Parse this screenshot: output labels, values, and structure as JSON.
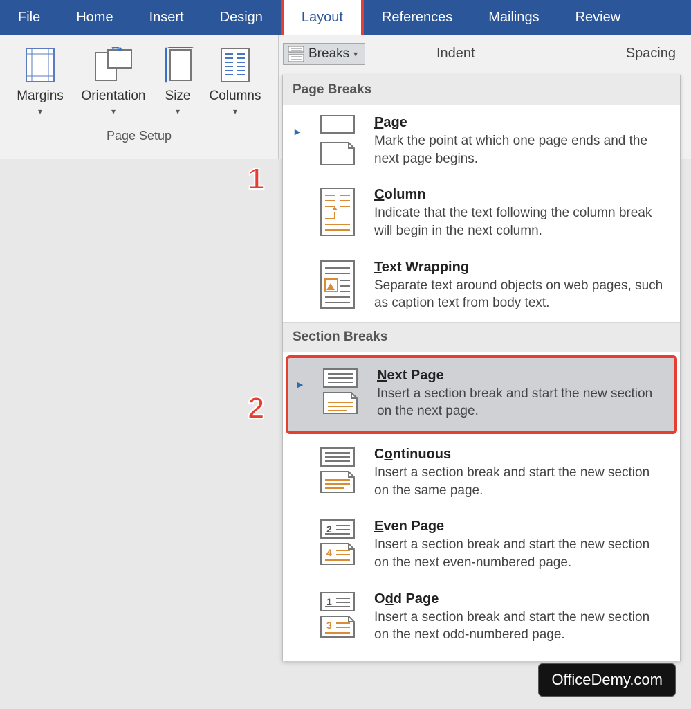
{
  "tabs": {
    "file": "File",
    "home": "Home",
    "insert": "Insert",
    "design": "Design",
    "layout": "Layout",
    "references": "References",
    "mailings": "Mailings",
    "review": "Review"
  },
  "ribbon": {
    "margins": "Margins",
    "orientation": "Orientation",
    "size": "Size",
    "columns": "Columns",
    "page_setup_group": "Page Setup",
    "breaks": "Breaks",
    "indent": "Indent",
    "spacing": "Spacing"
  },
  "dropdown": {
    "group_page_breaks": "Page Breaks",
    "group_section_breaks": "Section Breaks",
    "page": {
      "title_pre": "",
      "title_ul": "P",
      "title_post": "age",
      "desc": "Mark the point at which one page ends and the next page begins."
    },
    "column": {
      "title_pre": "",
      "title_ul": "C",
      "title_post": "olumn",
      "desc": "Indicate that the text following the column break will begin in the next column."
    },
    "text_wrapping": {
      "title_pre": "",
      "title_ul": "T",
      "title_post": "ext Wrapping",
      "desc": "Separate text around objects on web pages, such as caption text from body text."
    },
    "next_page": {
      "title_pre": "",
      "title_ul": "N",
      "title_post": "ext Page",
      "desc": "Insert a section break and start the new section on the next page."
    },
    "continuous": {
      "title_pre": "C",
      "title_ul": "o",
      "title_post": "ntinuous",
      "desc": "Insert a section break and start the new section on the same page."
    },
    "even_page": {
      "title_pre": "",
      "title_ul": "E",
      "title_post": "ven Page",
      "desc": "Insert a section break and start the new section on the next even-numbered page."
    },
    "odd_page": {
      "title_pre": "O",
      "title_ul": "d",
      "title_post": "d Page",
      "desc": "Insert a section break and start the new section on the next odd-numbered page."
    }
  },
  "annotations": {
    "one": "1",
    "two": "2"
  },
  "watermark": "OfficeDemy.com"
}
